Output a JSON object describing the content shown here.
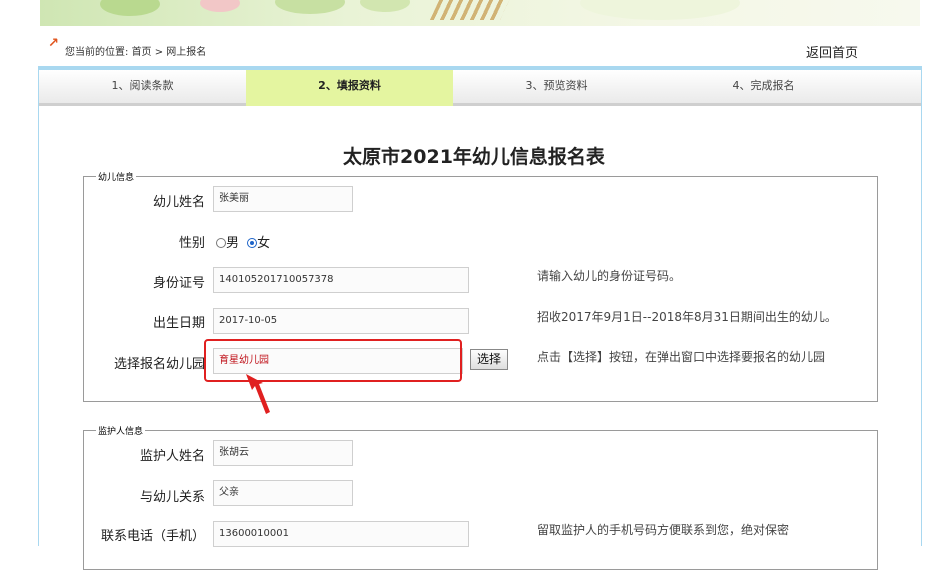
{
  "location": {
    "prefix": "您当前的位置:",
    "path": "首页 > 网上报名",
    "home_link": "返回首页"
  },
  "steps": [
    {
      "label": "1、阅读条款",
      "active": false
    },
    {
      "label": "2、填报资料",
      "active": true
    },
    {
      "label": "3、预览资料",
      "active": false
    },
    {
      "label": "4、完成报名",
      "active": false
    }
  ],
  "form_title": "太原市2021年幼儿信息报名表",
  "child_section": {
    "legend": "幼儿信息",
    "name_label": "幼儿姓名",
    "name_value": "张美丽",
    "gender_label": "性别",
    "gender_male": "男",
    "gender_female": "女",
    "gender_selected": "女",
    "id_label": "身份证号",
    "id_value": "140105201710057378",
    "id_hint": "请输入幼儿的身份证号码。",
    "birth_label": "出生日期",
    "birth_value": "2017-10-05",
    "birth_hint": "招收2017年9月1日--2018年8月31日期间出生的幼儿。",
    "kinder_label": "选择报名幼儿园",
    "kinder_value": "育星幼儿园",
    "select_button": "选择",
    "kinder_hint": "点击【选择】按钮，在弹出窗口中选择要报名的幼儿园"
  },
  "guardian_section": {
    "legend": "监护人信息",
    "name_label": "监护人姓名",
    "name_value": "张胡云",
    "relation_label": "与幼儿关系",
    "relation_value": "父亲",
    "phone_label": "联系电话（手机）",
    "phone_value": "13600010001",
    "phone_hint": "留取监护人的手机号码方便联系到您，绝对保密"
  },
  "colors": {
    "accent_tab": "#e4f5a0",
    "frame_border": "#a9d8f0",
    "highlight": "#e02020",
    "kinder_text": "#c0141c"
  }
}
